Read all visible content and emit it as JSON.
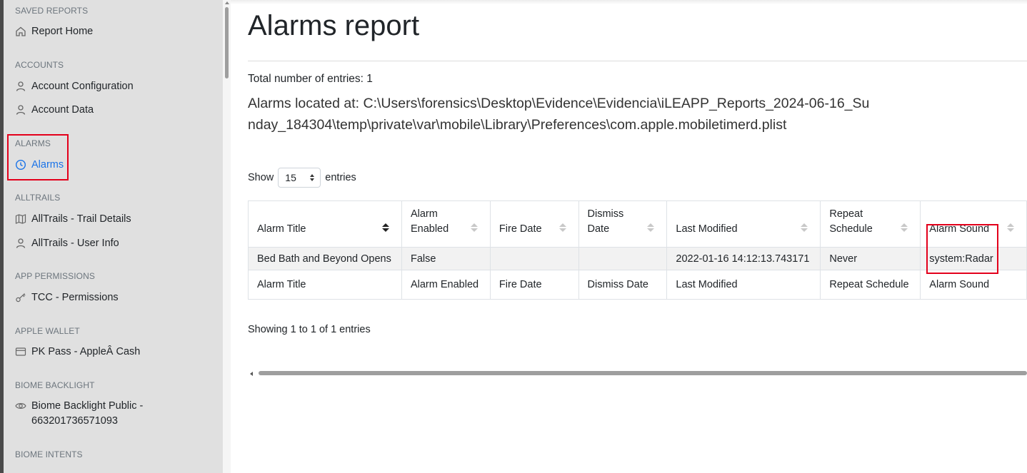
{
  "sidebar": {
    "sections": [
      {
        "header": "SAVED REPORTS",
        "items": [
          {
            "label": "Report Home",
            "icon": "home-icon"
          }
        ]
      },
      {
        "header": "ACCOUNTS",
        "items": [
          {
            "label": "Account Configuration",
            "icon": "user-icon"
          },
          {
            "label": "Account Data",
            "icon": "user-icon"
          }
        ]
      },
      {
        "header": "ALARMS",
        "items": [
          {
            "label": "Alarms",
            "icon": "clock-icon",
            "active": true
          }
        ]
      },
      {
        "header": "ALLTRAILS",
        "items": [
          {
            "label": "AllTrails - Trail Details",
            "icon": "map-icon"
          },
          {
            "label": "AllTrails - User Info",
            "icon": "user-icon"
          }
        ]
      },
      {
        "header": "APP PERMISSIONS",
        "items": [
          {
            "label": "TCC - Permissions",
            "icon": "key-icon"
          }
        ]
      },
      {
        "header": "APPLE WALLET",
        "items": [
          {
            "label": "PK Pass - AppleÂ Cash",
            "icon": "credit-card-icon"
          }
        ]
      },
      {
        "header": "BIOME BACKLIGHT",
        "items": [
          {
            "label": "Biome Backlight Public - 663201736571093",
            "icon": "eye-icon"
          }
        ]
      },
      {
        "header": "BIOME INTENTS",
        "items": []
      }
    ]
  },
  "main": {
    "title": "Alarms report",
    "total_entries": "Total number of entries: 1",
    "location": "Alarms located at: C:\\Users\\forensics\\Desktop\\Evidence\\Evidencia\\iLEAPP_Reports_2024-06-16_Sunday_184304\\temp\\private\\var\\mobile\\Library\\Preferences\\com.apple.mobiletimerd.plist",
    "length": {
      "show_label": "Show",
      "selected": "15",
      "entries_label": "entries"
    },
    "table": {
      "columns": [
        "Alarm Title",
        "Alarm Enabled",
        "Fire Date",
        "Dismiss Date",
        "Last Modified",
        "Repeat Schedule",
        "Alarm Sound"
      ],
      "rows": [
        [
          "Bed Bath and Beyond Opens",
          "False",
          "",
          "",
          "2022-01-16 14:12:13.743171",
          "Never",
          "system:Radar"
        ]
      ],
      "footer": [
        "Alarm Title",
        "Alarm Enabled",
        "Fire Date",
        "Dismiss Date",
        "Last Modified",
        "Repeat Schedule",
        "Alarm Sound"
      ]
    },
    "info": "Showing 1 to 1 of 1 entries"
  },
  "colors": {
    "active": "#1a73e8",
    "highlight": "#e3001b",
    "sidebar_bg": "#e0e0e0"
  }
}
